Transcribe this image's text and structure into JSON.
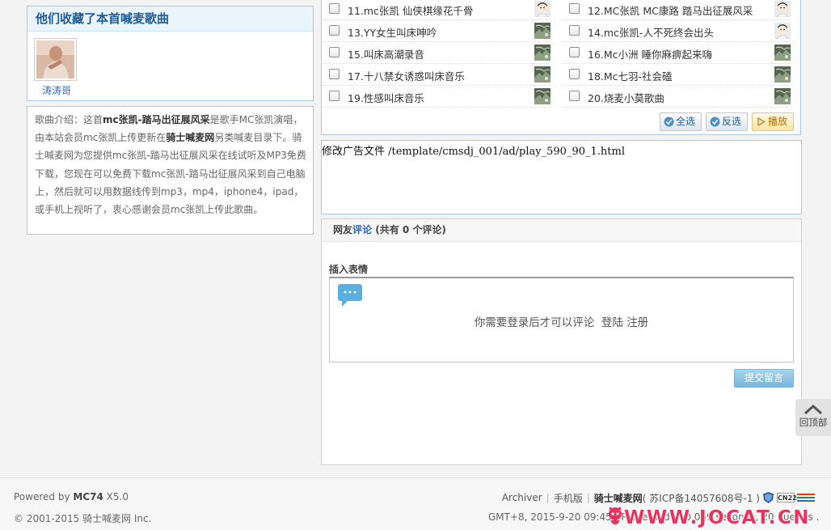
{
  "favorites": {
    "title": "他们收藏了本首喊麦歌曲",
    "users": [
      {
        "name": "涛涛哥"
      }
    ]
  },
  "intro": {
    "prefix": "歌曲介绍：这首",
    "song_name": "mc张凯-踏马出征展风采",
    "middle1": "是歌手MC张凯演唱，由本站会员mc张凯上传更新在",
    "site_name": "骑士喊麦网",
    "rest": "另类喊麦目录下。骑士喊麦网为您提供mc张凯-踏马出征展风采在线试听及MP3免费下载，您现在可以免费下载mc张凯-踏马出征展风采到自己电脑上，然后就可以用数据线传到mp3，mp4，iphone4，ipad，或手机上视听了，衷心感谢会员mc张凯上传此歌曲。"
  },
  "songs": [
    {
      "title": "11.mc张凯 仙侠棋缘花千骨",
      "thumb": "face"
    },
    {
      "title": "12.MC张凯 MC康路 踏马出征展风采",
      "thumb": "face"
    },
    {
      "title": "13.YY女生叫床呻吟",
      "thumb": "landscape"
    },
    {
      "title": "14.mc张凯-人不死终会出头",
      "thumb": "face"
    },
    {
      "title": "15.叫床高潮录音",
      "thumb": "landscape"
    },
    {
      "title": "16.Mc小洲 睡你麻痹起来嗨",
      "thumb": "landscape"
    },
    {
      "title": "17.十八禁女诱惑叫床音乐",
      "thumb": "landscape"
    },
    {
      "title": "18.Mc七羽-社会磕",
      "thumb": "landscape"
    },
    {
      "title": "19.性感叫床音乐",
      "thumb": "landscape"
    },
    {
      "title": "20.烧麦小莫歌曲",
      "thumb": "landscape"
    }
  ],
  "song_buttons": {
    "select_all": "全选",
    "invert": "反选",
    "play": "播放"
  },
  "ad": {
    "text": "修改广告文件 /template/cmsdj_001/ad/play_590_90_1.html"
  },
  "comments": {
    "head_prefix": "网友",
    "head_link": "评论",
    "head_count": "(共有 0 个评论)",
    "face_label": "插入表情",
    "login_tip": "你需要登录后才可以评论",
    "login_link": "登陆",
    "register_link": "注册",
    "submit": "提交留言"
  },
  "back_to_top": {
    "label": "回顶部"
  },
  "footer": {
    "powered_prefix": "Powered by ",
    "powered_brand": "MC74",
    "powered_version": " X5.0",
    "copyright": "© 2001-2015 骑士喊麦网 Inc.",
    "archiver": "Archiver",
    "mobile": "手机版",
    "site_name": "骑士喊麦网",
    "icp": "( 苏ICP备14057608号-1 )",
    "cnzz": "CN22",
    "time_info": "GMT+8, 2015-9-20 09:45 , Processed in 0.069 seconds, 20 queries .",
    "watermark": "WWW.JOCAT.CN"
  },
  "colors": {
    "accent": "#2d6cb5",
    "watermark": "#e8345f",
    "submit": "#78b6db"
  }
}
